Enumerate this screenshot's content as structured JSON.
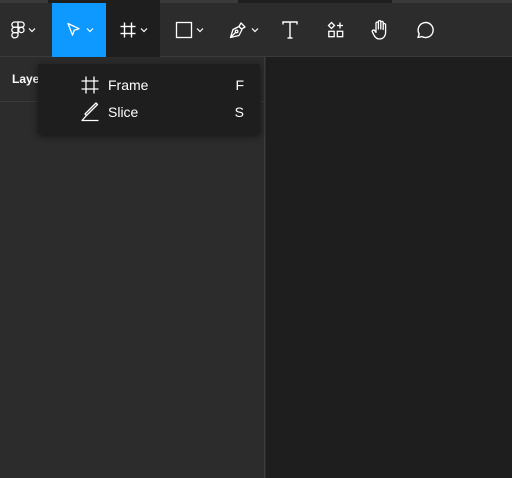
{
  "toolbar": {
    "main_menu": {
      "icon": "figma-logo-icon"
    },
    "move_tool": {
      "icon": "move-arrow-icon",
      "active": true
    },
    "frame_tool": {
      "icon": "frame-hash-icon",
      "open": true
    },
    "shape_tool": {
      "icon": "rectangle-icon"
    },
    "pen_tool": {
      "icon": "pen-icon"
    },
    "text_tool": {
      "icon": "text-icon"
    },
    "resources_tool": {
      "icon": "resources-icon"
    },
    "hand_tool": {
      "icon": "hand-icon"
    },
    "comment_tool": {
      "icon": "comment-bubble-icon"
    }
  },
  "left_panel": {
    "tab_label": "Laye"
  },
  "frame_menu": {
    "items": [
      {
        "label": "Frame",
        "shortcut": "F",
        "icon": "frame-hash-icon"
      },
      {
        "label": "Slice",
        "shortcut": "S",
        "icon": "slice-knife-icon"
      }
    ]
  },
  "colors": {
    "toolbar_bg": "#2c2c2c",
    "active_tool": "#0d99ff",
    "open_tool": "#1e1e1e",
    "canvas_bg": "#1e1e1e",
    "panel_bg": "#2c2c2c",
    "menu_bg": "#1e1e1e"
  }
}
